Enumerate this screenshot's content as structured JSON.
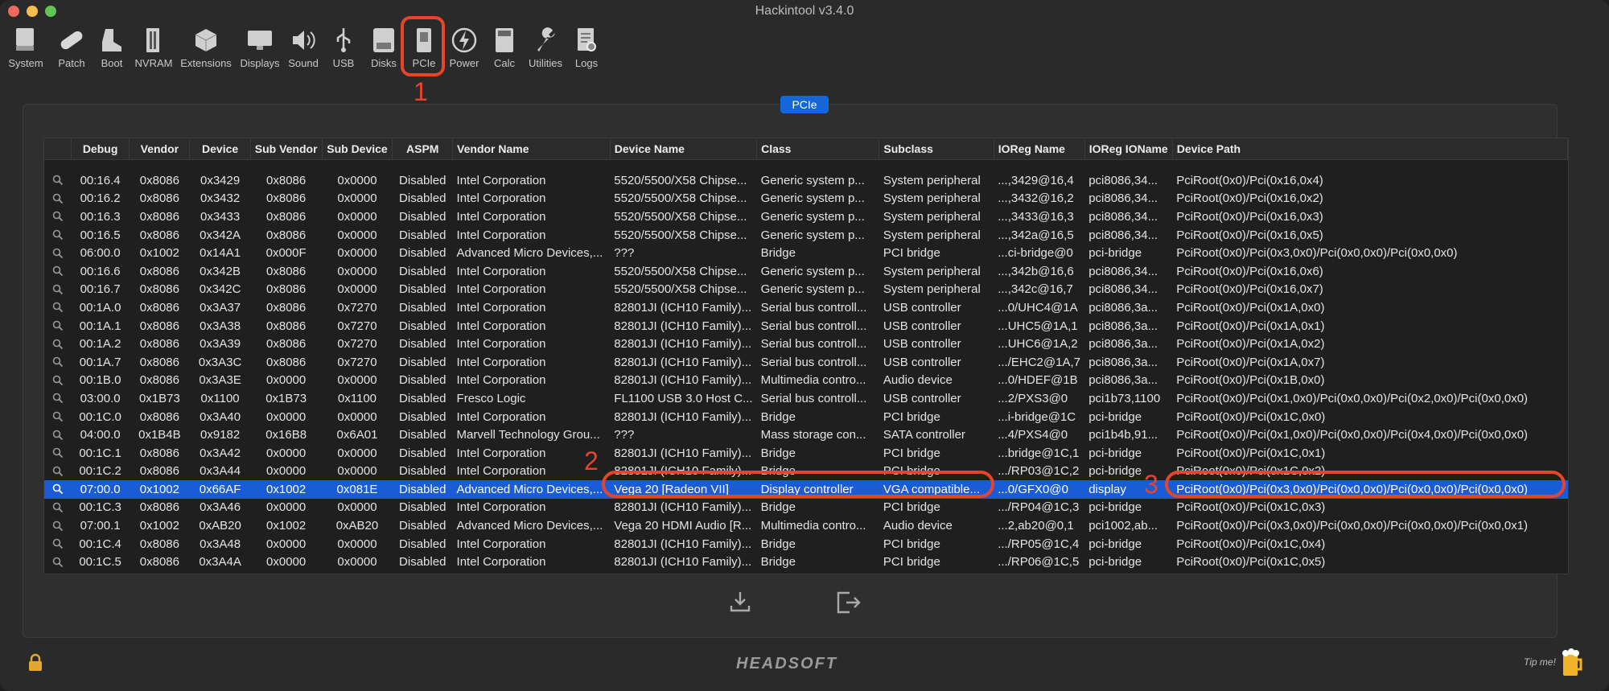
{
  "window": {
    "title": "Hackintool v3.4.0",
    "traffic_colors": [
      "#ed6a5e",
      "#f5bf4f",
      "#61c554"
    ]
  },
  "toolbar": {
    "items": [
      {
        "label": "System",
        "icon": "system-icon"
      },
      {
        "label": "Patch",
        "icon": "patch-icon"
      },
      {
        "label": "Boot",
        "icon": "boot-icon"
      },
      {
        "label": "NVRAM",
        "icon": "nvram-icon"
      },
      {
        "label": "Extensions",
        "icon": "extensions-icon"
      },
      {
        "label": "Displays",
        "icon": "displays-icon"
      },
      {
        "label": "Sound",
        "icon": "sound-icon"
      },
      {
        "label": "USB",
        "icon": "usb-icon"
      },
      {
        "label": "Disks",
        "icon": "disks-icon"
      },
      {
        "label": "PCIe",
        "icon": "pcie-icon"
      },
      {
        "label": "Power",
        "icon": "power-icon"
      },
      {
        "label": "Calc",
        "icon": "calc-icon"
      },
      {
        "label": "Utilities",
        "icon": "utilities-icon"
      },
      {
        "label": "Logs",
        "icon": "logs-icon"
      }
    ],
    "active": "PCIe"
  },
  "panel": {
    "badge": "PCIe"
  },
  "annotations": {
    "n1": "1",
    "n2": "2",
    "n3": "3",
    "color": "#e7452a"
  },
  "table": {
    "columns": [
      "",
      "Debug",
      "Vendor",
      "Device",
      "Sub Vendor",
      "Sub Device",
      "ASPM",
      "Vendor Name",
      "Device Name",
      "Class",
      "Subclass",
      "IOReg Name",
      "IOReg IOName",
      "Device Path"
    ],
    "rows": [
      [
        "00:16.4",
        "0x8086",
        "0x3429",
        "0x8086",
        "0x0000",
        "Disabled",
        "Intel Corporation",
        "5520/5500/X58 Chipse...",
        "Generic system p...",
        "System peripheral",
        "...,3429@16,4",
        "pci8086,34...",
        "PciRoot(0x0)/Pci(0x16,0x4)"
      ],
      [
        "00:16.2",
        "0x8086",
        "0x3432",
        "0x8086",
        "0x0000",
        "Disabled",
        "Intel Corporation",
        "5520/5500/X58 Chipse...",
        "Generic system p...",
        "System peripheral",
        "...,3432@16,2",
        "pci8086,34...",
        "PciRoot(0x0)/Pci(0x16,0x2)"
      ],
      [
        "00:16.3",
        "0x8086",
        "0x3433",
        "0x8086",
        "0x0000",
        "Disabled",
        "Intel Corporation",
        "5520/5500/X58 Chipse...",
        "Generic system p...",
        "System peripheral",
        "...,3433@16,3",
        "pci8086,34...",
        "PciRoot(0x0)/Pci(0x16,0x3)"
      ],
      [
        "00:16.5",
        "0x8086",
        "0x342A",
        "0x8086",
        "0x0000",
        "Disabled",
        "Intel Corporation",
        "5520/5500/X58 Chipse...",
        "Generic system p...",
        "System peripheral",
        "...,342a@16,5",
        "pci8086,34...",
        "PciRoot(0x0)/Pci(0x16,0x5)"
      ],
      [
        "06:00.0",
        "0x1002",
        "0x14A1",
        "0x000F",
        "0x0000",
        "Disabled",
        "Advanced Micro Devices,...",
        "???",
        "Bridge",
        "PCI bridge",
        "...ci-bridge@0",
        "pci-bridge",
        "PciRoot(0x0)/Pci(0x3,0x0)/Pci(0x0,0x0)/Pci(0x0,0x0)"
      ],
      [
        "00:16.6",
        "0x8086",
        "0x342B",
        "0x8086",
        "0x0000",
        "Disabled",
        "Intel Corporation",
        "5520/5500/X58 Chipse...",
        "Generic system p...",
        "System peripheral",
        "...,342b@16,6",
        "pci8086,34...",
        "PciRoot(0x0)/Pci(0x16,0x6)"
      ],
      [
        "00:16.7",
        "0x8086",
        "0x342C",
        "0x8086",
        "0x0000",
        "Disabled",
        "Intel Corporation",
        "5520/5500/X58 Chipse...",
        "Generic system p...",
        "System peripheral",
        "...,342c@16,7",
        "pci8086,34...",
        "PciRoot(0x0)/Pci(0x16,0x7)"
      ],
      [
        "00:1A.0",
        "0x8086",
        "0x3A37",
        "0x8086",
        "0x7270",
        "Disabled",
        "Intel Corporation",
        "82801JI (ICH10 Family)...",
        "Serial bus controll...",
        "USB controller",
        "...0/UHC4@1A",
        "pci8086,3a...",
        "PciRoot(0x0)/Pci(0x1A,0x0)"
      ],
      [
        "00:1A.1",
        "0x8086",
        "0x3A38",
        "0x8086",
        "0x7270",
        "Disabled",
        "Intel Corporation",
        "82801JI (ICH10 Family)...",
        "Serial bus controll...",
        "USB controller",
        "...UHC5@1A,1",
        "pci8086,3a...",
        "PciRoot(0x0)/Pci(0x1A,0x1)"
      ],
      [
        "00:1A.2",
        "0x8086",
        "0x3A39",
        "0x8086",
        "0x7270",
        "Disabled",
        "Intel Corporation",
        "82801JI (ICH10 Family)...",
        "Serial bus controll...",
        "USB controller",
        "...UHC6@1A,2",
        "pci8086,3a...",
        "PciRoot(0x0)/Pci(0x1A,0x2)"
      ],
      [
        "00:1A.7",
        "0x8086",
        "0x3A3C",
        "0x8086",
        "0x7270",
        "Disabled",
        "Intel Corporation",
        "82801JI (ICH10 Family)...",
        "Serial bus controll...",
        "USB controller",
        ".../EHC2@1A,7",
        "pci8086,3a...",
        "PciRoot(0x0)/Pci(0x1A,0x7)"
      ],
      [
        "00:1B.0",
        "0x8086",
        "0x3A3E",
        "0x0000",
        "0x0000",
        "Disabled",
        "Intel Corporation",
        "82801JI (ICH10 Family)...",
        "Multimedia contro...",
        "Audio device",
        "...0/HDEF@1B",
        "pci8086,3a...",
        "PciRoot(0x0)/Pci(0x1B,0x0)"
      ],
      [
        "03:00.0",
        "0x1B73",
        "0x1100",
        "0x1B73",
        "0x1100",
        "Disabled",
        "Fresco Logic",
        "FL1100 USB 3.0 Host C...",
        "Serial bus controll...",
        "USB controller",
        "...2/PXS3@0",
        "pci1b73,1100",
        "PciRoot(0x0)/Pci(0x1,0x0)/Pci(0x0,0x0)/Pci(0x2,0x0)/Pci(0x0,0x0)"
      ],
      [
        "00:1C.0",
        "0x8086",
        "0x3A40",
        "0x0000",
        "0x0000",
        "Disabled",
        "Intel Corporation",
        "82801JI (ICH10 Family)...",
        "Bridge",
        "PCI bridge",
        "...i-bridge@1C",
        "pci-bridge",
        "PciRoot(0x0)/Pci(0x1C,0x0)"
      ],
      [
        "04:00.0",
        "0x1B4B",
        "0x9182",
        "0x16B8",
        "0x6A01",
        "Disabled",
        "Marvell Technology Grou...",
        "???",
        "Mass storage con...",
        "SATA controller",
        "...4/PXS4@0",
        "pci1b4b,91...",
        "PciRoot(0x0)/Pci(0x1,0x0)/Pci(0x0,0x0)/Pci(0x4,0x0)/Pci(0x0,0x0)"
      ],
      [
        "00:1C.1",
        "0x8086",
        "0x3A42",
        "0x0000",
        "0x0000",
        "Disabled",
        "Intel Corporation",
        "82801JI (ICH10 Family)...",
        "Bridge",
        "PCI bridge",
        "...bridge@1C,1",
        "pci-bridge",
        "PciRoot(0x0)/Pci(0x1C,0x1)"
      ],
      [
        "00:1C.2",
        "0x8086",
        "0x3A44",
        "0x0000",
        "0x0000",
        "Disabled",
        "Intel Corporation",
        "82801JI (ICH10 Family)...",
        "Bridge",
        "PCI bridge",
        ".../RP03@1C,2",
        "pci-bridge",
        "PciRoot(0x0)/Pci(0x1C,0x2)"
      ],
      [
        "07:00.0",
        "0x1002",
        "0x66AF",
        "0x1002",
        "0x081E",
        "Disabled",
        "Advanced Micro Devices,...",
        "Vega 20 [Radeon VII]",
        "Display controller",
        "VGA compatible...",
        "...0/GFX0@0",
        "display",
        "PciRoot(0x0)/Pci(0x3,0x0)/Pci(0x0,0x0)/Pci(0x0,0x0)/Pci(0x0,0x0)"
      ],
      [
        "00:1C.3",
        "0x8086",
        "0x3A46",
        "0x0000",
        "0x0000",
        "Disabled",
        "Intel Corporation",
        "82801JI (ICH10 Family)...",
        "Bridge",
        "PCI bridge",
        ".../RP04@1C,3",
        "pci-bridge",
        "PciRoot(0x0)/Pci(0x1C,0x3)"
      ],
      [
        "07:00.1",
        "0x1002",
        "0xAB20",
        "0x1002",
        "0xAB20",
        "Disabled",
        "Advanced Micro Devices,...",
        "Vega 20 HDMI Audio [R...",
        "Multimedia contro...",
        "Audio device",
        "...2,ab20@0,1",
        "pci1002,ab...",
        "PciRoot(0x0)/Pci(0x3,0x0)/Pci(0x0,0x0)/Pci(0x0,0x0)/Pci(0x0,0x1)"
      ],
      [
        "00:1C.4",
        "0x8086",
        "0x3A48",
        "0x0000",
        "0x0000",
        "Disabled",
        "Intel Corporation",
        "82801JI (ICH10 Family)...",
        "Bridge",
        "PCI bridge",
        ".../RP05@1C,4",
        "pci-bridge",
        "PciRoot(0x0)/Pci(0x1C,0x4)"
      ],
      [
        "00:1C.5",
        "0x8086",
        "0x3A4A",
        "0x0000",
        "0x0000",
        "Disabled",
        "Intel Corporation",
        "82801JI (ICH10 Family)...",
        "Bridge",
        "PCI bridge",
        ".../RP06@1C,5",
        "pci-bridge",
        "PciRoot(0x0)/Pci(0x1C,0x5)"
      ]
    ],
    "selected_index": 17
  },
  "footer": {
    "brand": "HEADSOFT",
    "tip": "Tip me!"
  }
}
